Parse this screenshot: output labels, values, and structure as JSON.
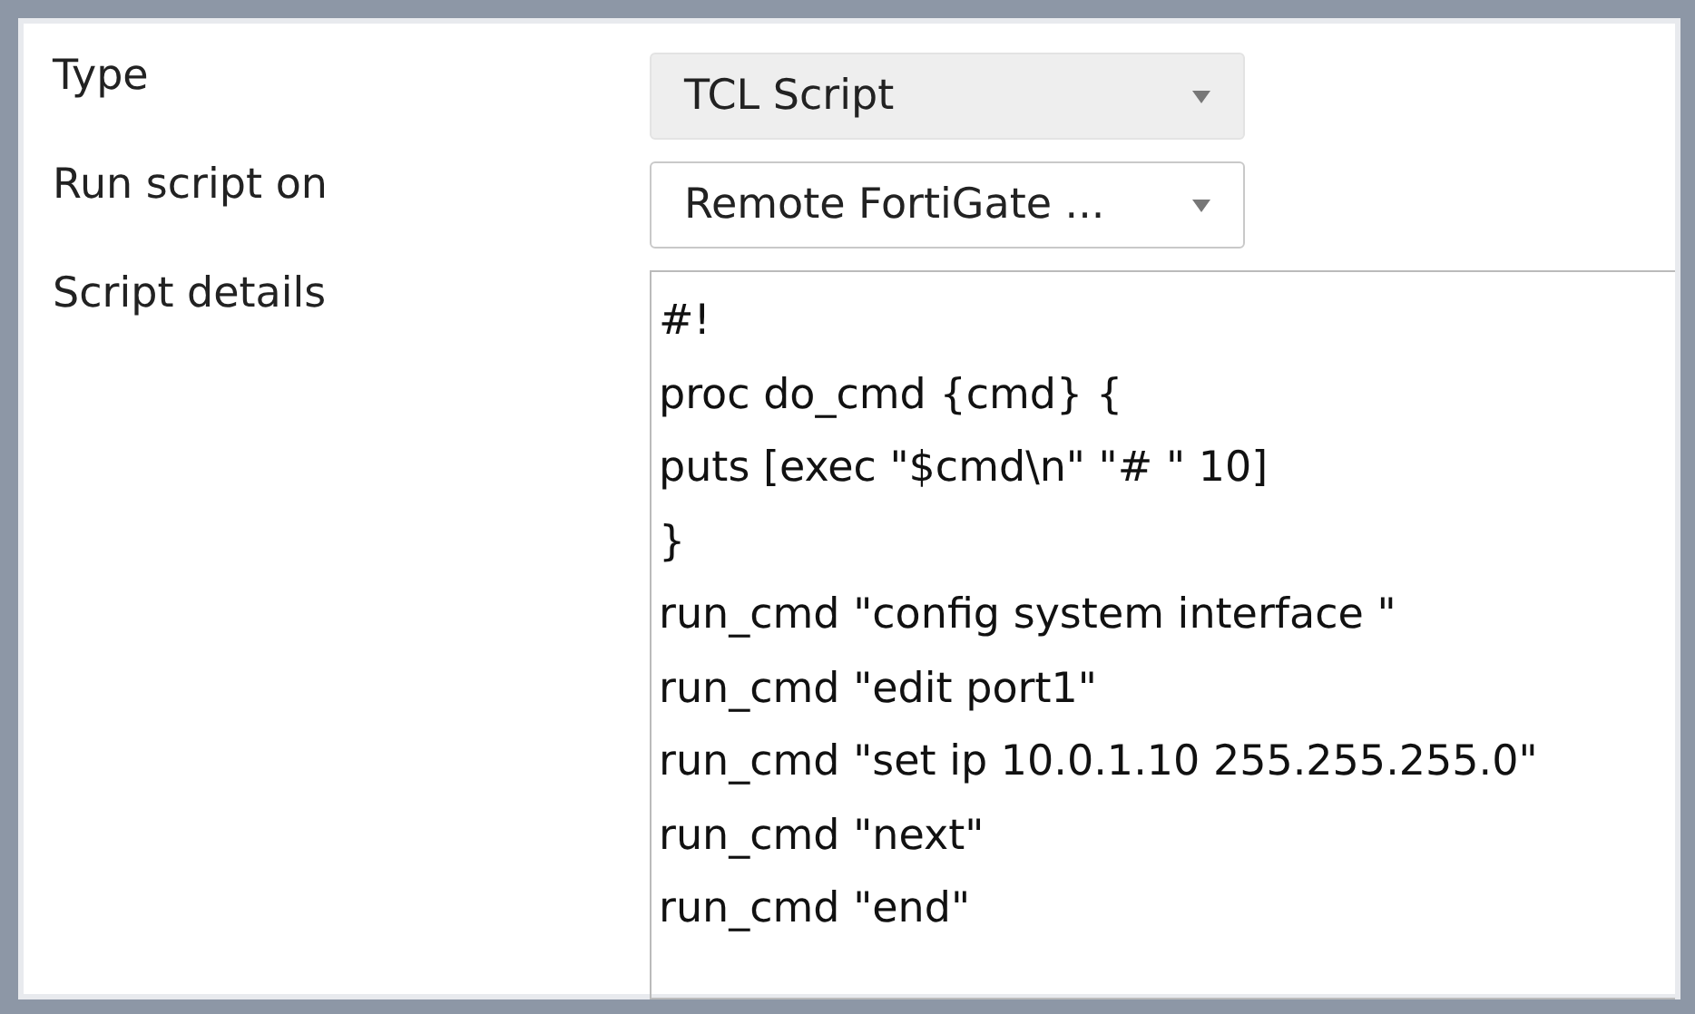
{
  "form": {
    "rows": [
      {
        "label": "Type",
        "kind": "select",
        "value": "TCL Script",
        "disabled": true
      },
      {
        "label": "Run script on",
        "kind": "select",
        "value": "Remote FortiGate ...",
        "disabled": false
      },
      {
        "label": "Script details",
        "kind": "textarea",
        "lines": [
          "#!",
          "proc do_cmd {cmd} {",
          "puts [exec \"$cmd\\n\" \"# \" 10]",
          "}",
          "run_cmd \"config system interface \"",
          "run_cmd \"edit port1\"",
          "run_cmd \"set ip 10.0.1.10 255.255.255.0\"",
          "run_cmd \"next\"",
          "run_cmd \"end\""
        ]
      }
    ]
  }
}
